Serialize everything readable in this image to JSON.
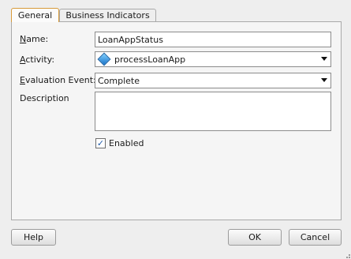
{
  "tabs": {
    "general": "General",
    "business_indicators": "Business Indicators"
  },
  "form": {
    "name_label_first": "N",
    "name_label_rest": "ame:",
    "name_value": "LoanAppStatus",
    "activity_label_first": "A",
    "activity_label_rest": "ctivity:",
    "activity_value": "processLoanApp",
    "event_label_first": "E",
    "event_label_rest": "valuation Event:",
    "event_value": "Complete",
    "description_label": "Description",
    "enabled_label": "Enabled",
    "enabled_checked": true
  },
  "buttons": {
    "help": "Help",
    "ok": "OK",
    "cancel": "Cancel"
  },
  "icons": {
    "activity": "blue-diamond-icon",
    "dropdown": "chevron-down-icon",
    "check": "checkmark-icon"
  }
}
